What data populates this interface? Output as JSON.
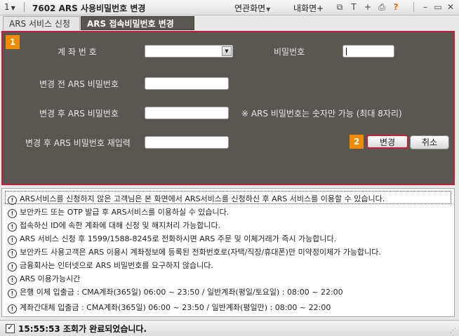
{
  "titlebar": {
    "screen_number": "1",
    "title": "7602 ARS 사용비밀번호 변경",
    "menu_related": "연관화면",
    "menu_mine": "내화면",
    "plus": "+",
    "icon_t": "T",
    "icon_plus2": "+",
    "help": "?"
  },
  "tabs": [
    {
      "label": "ARS 서비스 신청"
    },
    {
      "label": "ARS 접속비밀번호 변경"
    }
  ],
  "form": {
    "badge1": "1",
    "account_label": "계 좌 번 호",
    "password_label": "비밀번호",
    "before_label": "변경 전 ARS 비밀번호",
    "after_label": "변경 후 ARS 비밀번호",
    "confirm_label": "변경 후 ARS 비밀번호 재입력",
    "note": "※ ARS 비밀번호는 숫자만 가능 (최대 8자리)",
    "badge2": "2",
    "change_button": "변경",
    "cancel_button": "취소"
  },
  "info": {
    "lines": [
      "ARS서비스를 신청하지 않은 고객님은 본 화면에서 ARS서비스를 신청하신 후 ARS 서비스를 이용할 수 있습니다.",
      "보안카드 또는 OTP 발급 후 ARS서비스를 이용하실 수 있습니다.",
      "접속하신 ID에 속한 계좌에 대해 신청 및 해지처리 가능합니다.",
      "ARS 서비스 신청 후 1599/1588-8245로 전화하시면 ARS 주문 및 이체거래가 즉시 가능합니다.",
      "보안카드 사용고객은 ARS 이용시 계좌정보에 등록된 전화번호로(자택/직장/휴대폰)만 미약정이체가 가능합니다.",
      "금융회사는 인터넷으로 ARS 비밀번호를 요구하지 않습니다.",
      "ARS 이용가능시간",
      "은행 이체 입출금 : CMA계좌(365일)  06:00 ~ 23:50 / 일반계좌(평일/토요일) : 08:00 ~ 22:00",
      "계좌간대체 입출금 : CMA계좌(365일)  06:00 ~ 23:50 / 일반계좌(평일만) : 08:00 ~ 22:00"
    ],
    "icon_glyph": "!"
  },
  "status": {
    "check": "✓",
    "text": "15:55:53 조회가 완료되었습니다."
  }
}
